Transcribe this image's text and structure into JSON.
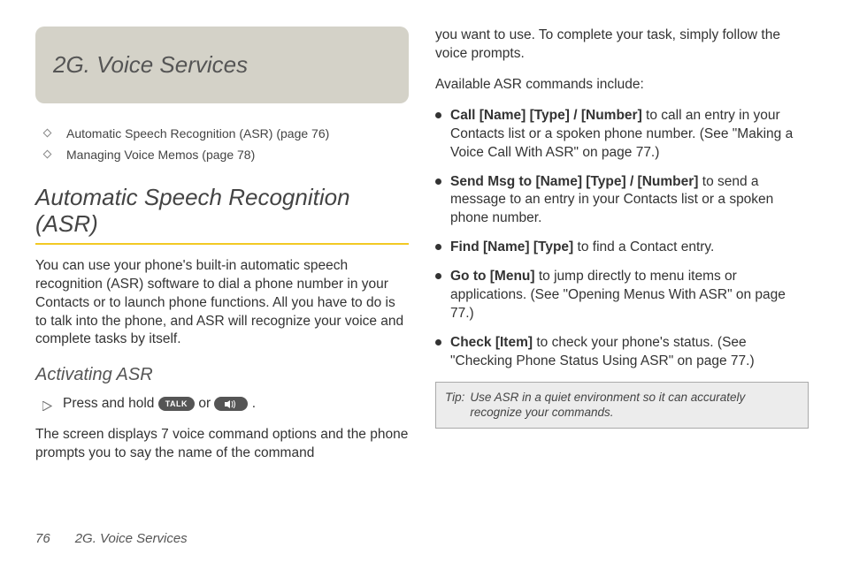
{
  "banner_title": "2G. Voice Services",
  "toc": {
    "item1": "Automatic Speech Recognition (ASR) (page 76)",
    "item2": "Managing Voice Memos (page 78)"
  },
  "section_heading": "Automatic Speech Recognition (ASR)",
  "intro_para": "You can use your phone's built-in automatic speech recognition (ASR) software to dial a phone number in your Contacts or to launch phone functions. All you have to do is to talk into the phone, and ASR will recognize your voice and complete tasks by itself.",
  "sub_heading": "Activating ASR",
  "step_prefix": "Press and hold ",
  "step_mid": " or ",
  "step_suffix": " .",
  "key_talk": "TALK",
  "screen_para": "The screen displays 7 voice command options and the phone prompts you to say the name of the command",
  "col2_top": "you want to use. To complete your task, simply follow the voice prompts.",
  "avail_intro": "Available ASR commands include:",
  "commands": {
    "c1": {
      "cmd": "Call [Name] [Type] / [Number]",
      "rest": " to call an entry in your Contacts list or a spoken phone number. (See \"Making a Voice Call With ASR\" on page 77.)"
    },
    "c2": {
      "cmd": "Send Msg to [Name] [Type] / [Number]",
      "rest": " to send a message to an entry in your Contacts list or a spoken phone number."
    },
    "c3": {
      "cmd": "Find [Name] [Type]",
      "rest": " to find a Contact entry."
    },
    "c4": {
      "cmd": "Go to [Menu]",
      "rest": " to jump directly to menu items or applications. (See \"Opening Menus With ASR\" on page 77.)"
    },
    "c5": {
      "cmd": "Check [Item]",
      "rest": " to check your phone's status. (See \"Checking Phone Status Using ASR\" on page 77.)"
    }
  },
  "tip": {
    "label": "Tip:",
    "text": "Use ASR in a quiet environment so it can accurately recognize your commands."
  },
  "footer": {
    "page": "76",
    "title": "2G. Voice Services"
  }
}
